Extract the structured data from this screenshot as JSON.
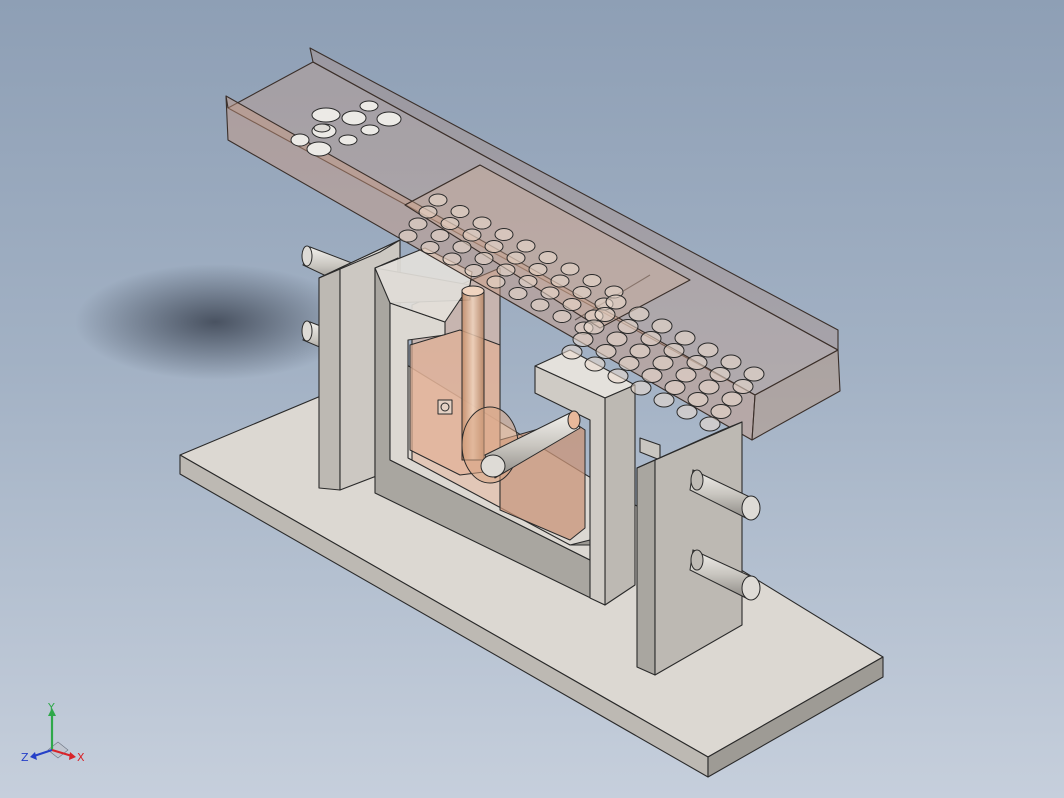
{
  "viewport": {
    "background_top": "#8e9fb5",
    "background_bottom": "#c6cfdc",
    "model_name": "cad-assembly-isometric-view"
  },
  "triad": {
    "x_label": "X",
    "y_label": "Y",
    "z_label": "Z",
    "x_color": "#d8242a",
    "y_color": "#2fa84a",
    "z_color": "#2540c8"
  },
  "colors": {
    "face_light": "#dcd8d2",
    "face_mid": "#bdb9b3",
    "face_dark": "#9a9791",
    "edge": "#2a2a2a",
    "transparent_tint": "#c99a80"
  }
}
